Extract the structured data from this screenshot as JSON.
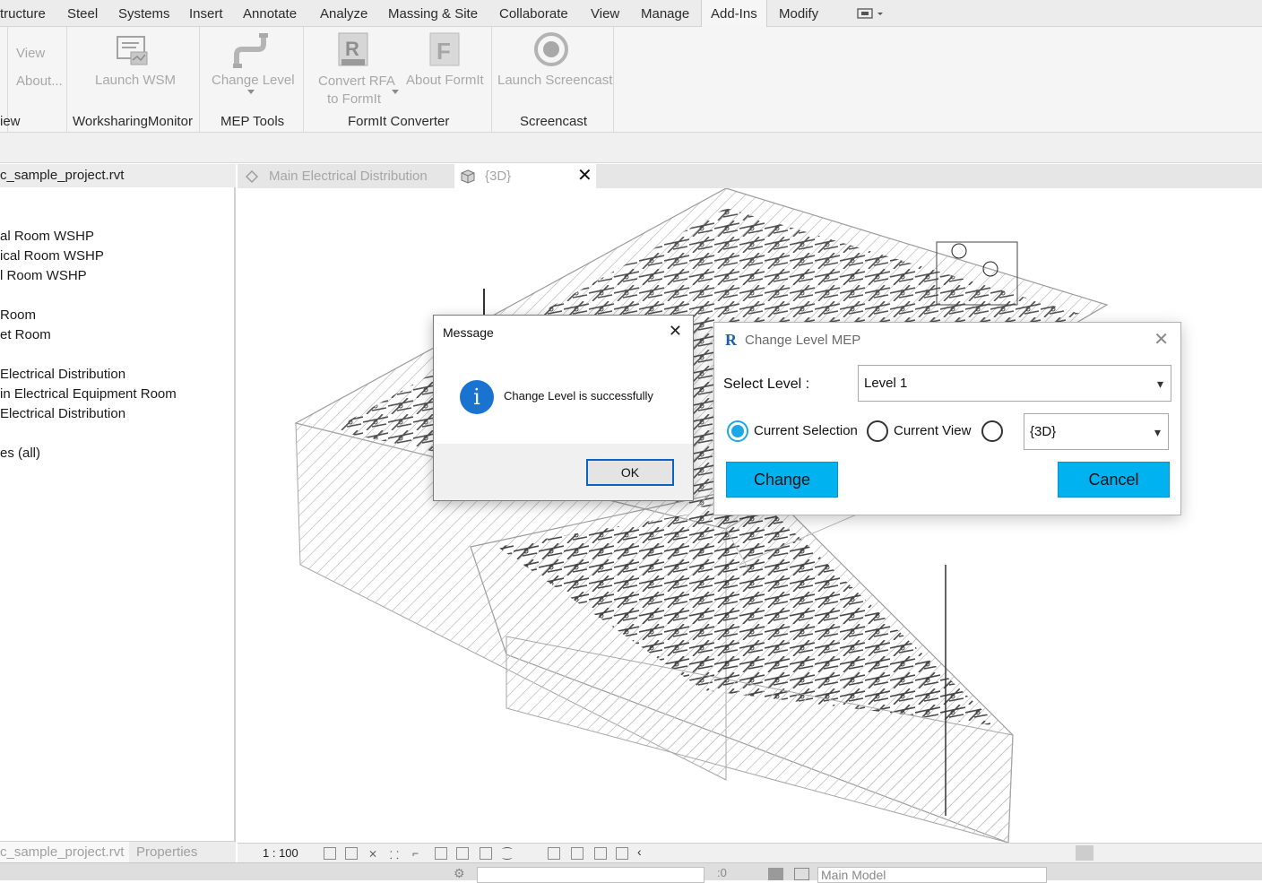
{
  "ribbon_tabs": [
    "tructure",
    "Steel",
    "Systems",
    "Insert",
    "Annotate",
    "Analyze",
    "Massing & Site",
    "Collaborate",
    "View",
    "Manage",
    "Add-Ins",
    "Modify"
  ],
  "ribbon": {
    "view_small": "View",
    "about_small": "About...",
    "launch_wsm": "Launch WSM",
    "change_level": "Change Level",
    "convert_rfa_line1": "Convert RFA",
    "convert_rfa_line2": "to FormIt",
    "about_formit": "About FormIt",
    "launch_screencast": "Launch Screencast",
    "panel_view": "iew",
    "panel_worksharing": "WorksharingMonitor",
    "panel_mep_tools": "MEP Tools",
    "panel_formit": "FormIt Converter",
    "panel_screencast": "Screencast"
  },
  "browser": {
    "title": "c_sample_project.rvt",
    "items": [
      "al Room WSHP",
      "ical Room WSHP",
      "l Room WSHP",
      " Room",
      "et Room",
      " Electrical Distribution",
      "in Electrical Equipment Room",
      "Electrical Distribution",
      "es (all)"
    ],
    "tab_project": "c_sample_project.rvt",
    "tab_properties": "Properties"
  },
  "view_tabs": {
    "tab1": "Main Electrical Distribution",
    "tab2": "{3D}"
  },
  "viewbar": {
    "scale": "1 : 100"
  },
  "statusbar": {
    "model": "Main Model",
    "zero": ":0"
  },
  "message_dialog": {
    "title": "Message",
    "text": "Change Level is successfully",
    "ok": "OK"
  },
  "change_level_dialog": {
    "title": "Change Level MEP",
    "select_level_label": "Select Level :",
    "level_value": "Level 1",
    "radio_current_selection": "Current Selection",
    "radio_current_view": "Current View",
    "view_value": "{3D}",
    "change_button": "Change",
    "cancel_button": "Cancel"
  },
  "colors": {
    "accent_blue": "#00b2f0",
    "info_icon": "#1a73d1",
    "ok_border": "#0b63c6"
  }
}
